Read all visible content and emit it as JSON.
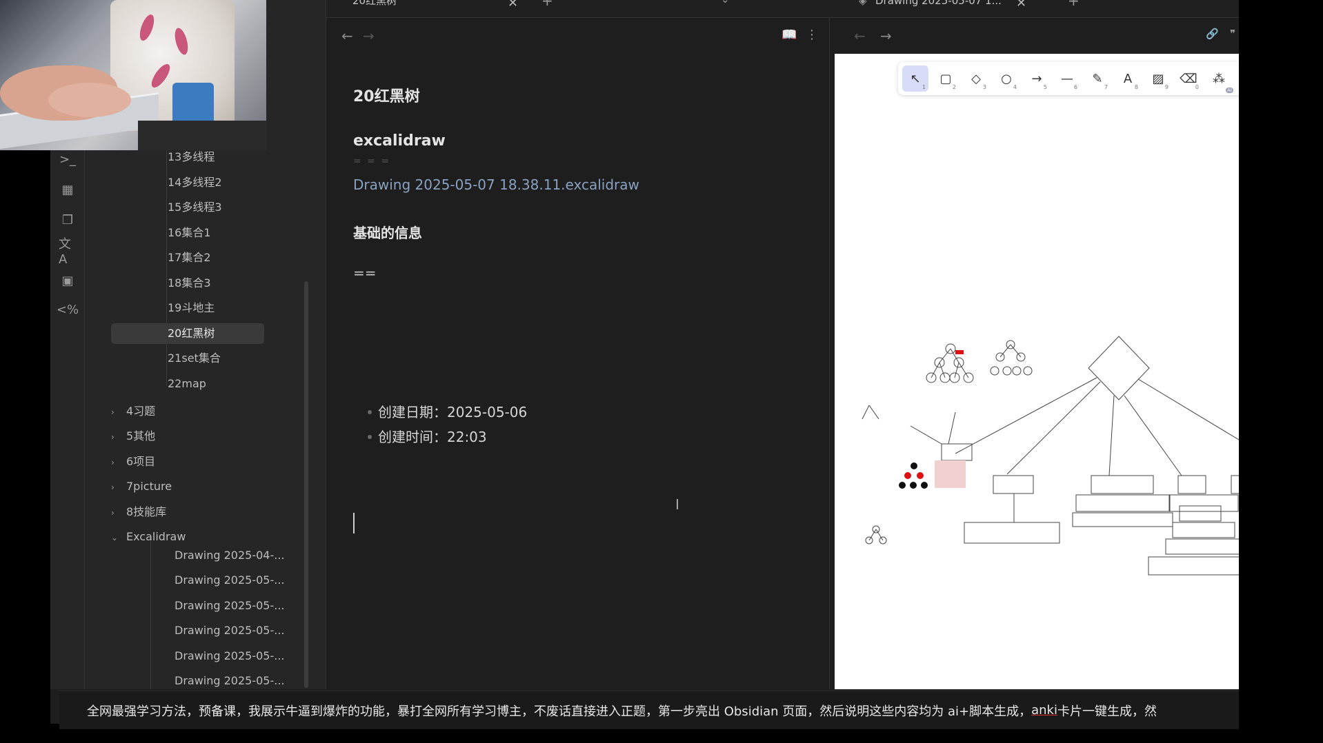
{
  "tabs": {
    "left": {
      "title": "20红黑树",
      "add": "+",
      "menu": "⌄",
      "close": "✕"
    },
    "right": {
      "title": "Drawing 2025-05-07 1...",
      "add": "+",
      "close": "✕"
    }
  },
  "ribbon": {
    "icons": [
      {
        "name": "terminal-icon",
        "glyph": ">_"
      },
      {
        "name": "calendar-icon",
        "glyph": "▦"
      },
      {
        "name": "copy-icon",
        "glyph": "❐"
      },
      {
        "name": "translate-icon",
        "glyph": "文A"
      },
      {
        "name": "template-icon",
        "glyph": "▣"
      },
      {
        "name": "templater-icon",
        "glyph": "<%"
      }
    ]
  },
  "explorer": {
    "items": [
      {
        "label": "13多线程",
        "level": 2
      },
      {
        "label": "14多线程2",
        "level": 2
      },
      {
        "label": "15多线程3",
        "level": 2
      },
      {
        "label": "16集合1",
        "level": 2
      },
      {
        "label": "17集合2",
        "level": 2
      },
      {
        "label": "18集合3",
        "level": 2
      },
      {
        "label": "19斗地主",
        "level": 2
      },
      {
        "label": "20红黑树",
        "level": 2,
        "active": true
      },
      {
        "label": "21set集合",
        "level": 2
      },
      {
        "label": "22map",
        "level": 2
      }
    ],
    "folders": [
      {
        "label": "4习题",
        "open": false
      },
      {
        "label": "5其他",
        "open": false
      },
      {
        "label": "6项目",
        "open": false
      },
      {
        "label": "7picture",
        "open": false
      },
      {
        "label": "8技能库",
        "open": false
      },
      {
        "label": "Excalidraw",
        "open": true
      }
    ],
    "drawings": [
      "Drawing 2025-04-...",
      "Drawing 2025-05-...",
      "Drawing 2025-05-...",
      "Drawing 2025-05-...",
      "Drawing 2025-05-...",
      "Drawing 2025-05-..."
    ]
  },
  "editor": {
    "title": "20红黑树",
    "heading": "excalidraw",
    "separator": "= = =",
    "link": "Drawing 2025-05-07 18.38.11.excalidraw",
    "section": "基础的信息",
    "eq": "==",
    "bullets": [
      "创建日期：2025-05-06",
      "创建时间：22:03"
    ],
    "ibeam": "I"
  },
  "nav": {
    "back": "←",
    "forward": "→",
    "reading": "📖",
    "more": "⋮"
  },
  "right_header": {
    "back": "←",
    "forward": "→",
    "link": "🔗",
    "quote": "❞",
    "save": "💾"
  },
  "excalidraw": {
    "tools": [
      {
        "name": "selection-tool-icon",
        "glyph": "↖",
        "num": "1",
        "active": true
      },
      {
        "name": "rectangle-tool-icon",
        "glyph": "▢",
        "num": "2"
      },
      {
        "name": "diamond-tool-icon",
        "glyph": "◇",
        "num": "3"
      },
      {
        "name": "ellipse-tool-icon",
        "glyph": "○",
        "num": "4"
      },
      {
        "name": "arrow-tool-icon",
        "glyph": "→",
        "num": "5"
      },
      {
        "name": "line-tool-icon",
        "glyph": "—",
        "num": "6"
      },
      {
        "name": "draw-tool-icon",
        "glyph": "✎",
        "num": "7"
      },
      {
        "name": "text-tool-icon",
        "glyph": "A",
        "num": "8"
      },
      {
        "name": "image-tool-icon",
        "glyph": "▨",
        "num": "9"
      },
      {
        "name": "eraser-tool-icon",
        "glyph": "⌫",
        "num": "0"
      },
      {
        "name": "ai-tool-icon",
        "glyph": "⁂",
        "badge": "AI"
      }
    ]
  },
  "subtitle": {
    "before": "全网最强学习方法，预备课，我展示牛逼到爆炸的功能，暴打全网所有学习博主，不废话直接进入正题，第一步亮出 Obsidian 页面，然后说明这些内容均为 ai+脚本生成，",
    "anki": "anki",
    "after": " 卡片一键生成，然"
  }
}
